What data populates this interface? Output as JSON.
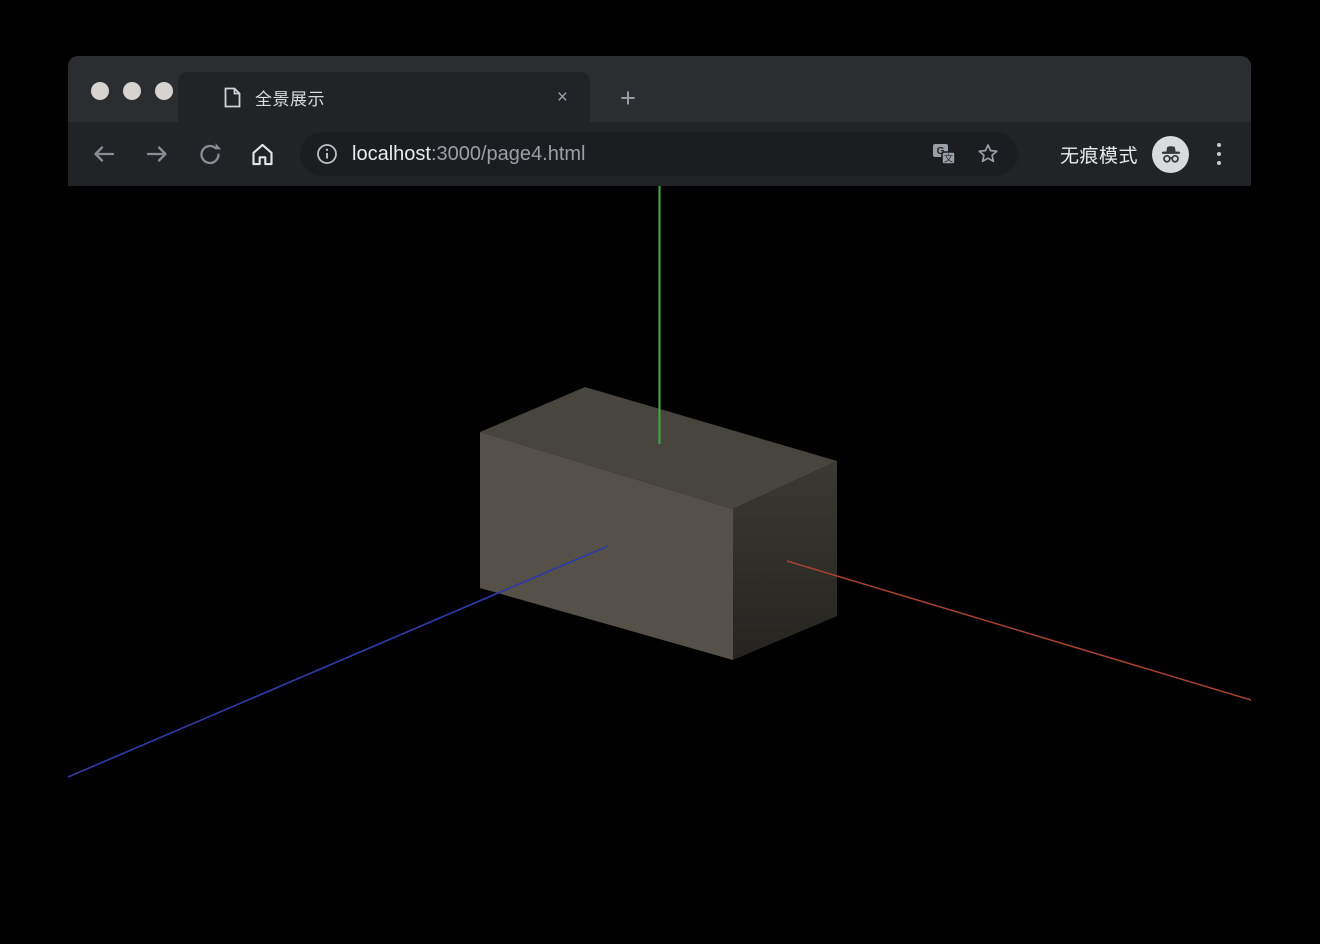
{
  "tab_bar": {
    "active_tab": {
      "title": "全景展示",
      "close_icon": "×"
    },
    "new_tab_icon": "+"
  },
  "toolbar": {
    "url": {
      "host": "localhost",
      "rest": ":3000/page4.html",
      "full": "localhost:3000/page4.html"
    },
    "incognito_label": "无痕模式",
    "translate_main_glyph": "G",
    "translate_sub_glyph": "文"
  },
  "scene": {
    "background": "#000000",
    "box": {
      "face_top": "#48453e",
      "face_front": "#555148",
      "face_right_top": "#3b3933",
      "face_right_bottom": "#252420"
    },
    "axes": {
      "x_color": "#a84330",
      "y_color": "#3fa53a",
      "z_color": "#2e3aa6"
    }
  },
  "colors": {
    "frame": "#2b2d31",
    "tab_toolbar": "#212326",
    "omnibox": "#1b1d20",
    "text_primary": "#e8eaed",
    "text_secondary": "#9aa0a6"
  }
}
